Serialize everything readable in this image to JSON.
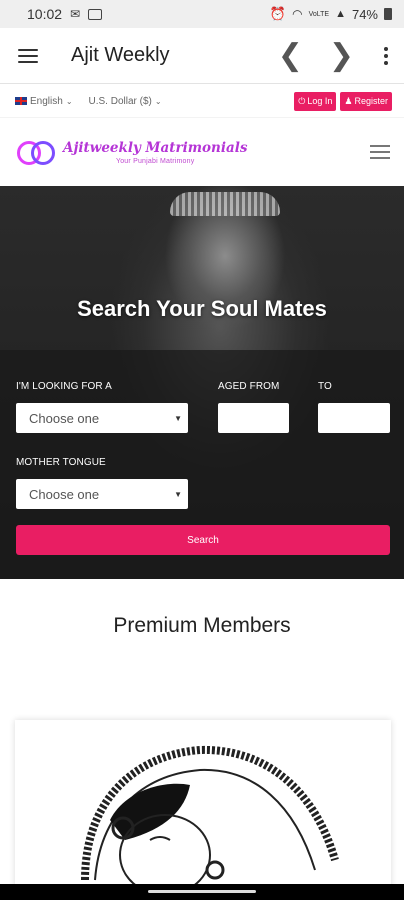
{
  "status_bar": {
    "time": "10:02",
    "notification_icons": [
      "mail-icon",
      "image-icon"
    ],
    "system_icons": [
      "alarm-icon",
      "wifi-icon",
      "volte-icon",
      "signal-icon"
    ],
    "volte_label": "VoLTE",
    "battery": "74%"
  },
  "app_bar": {
    "title": "Ajit Weekly",
    "back_glyph": "❮",
    "forward_glyph": "❯"
  },
  "top_bar": {
    "language": "English",
    "currency": "U.S. Dollar ($)",
    "login_label": "Log In",
    "register_label": "Register",
    "accent_color": "#e91e63"
  },
  "brand": {
    "name": "Ajitweekly Matrimonials",
    "tagline": "Your Punjabi Matrimony"
  },
  "hero": {
    "title": "Search Your Soul Mates",
    "looking_for_label": "I'M LOOKING FOR A",
    "looking_for_value": "Choose one",
    "aged_from_label": "AGED FROM",
    "to_label": "TO",
    "aged_from_value": "",
    "to_value": "",
    "mother_tongue_label": "MOTHER TONGUE",
    "mother_tongue_value": "Choose one",
    "search_label": "Search"
  },
  "premium": {
    "title": "Premium Members"
  }
}
